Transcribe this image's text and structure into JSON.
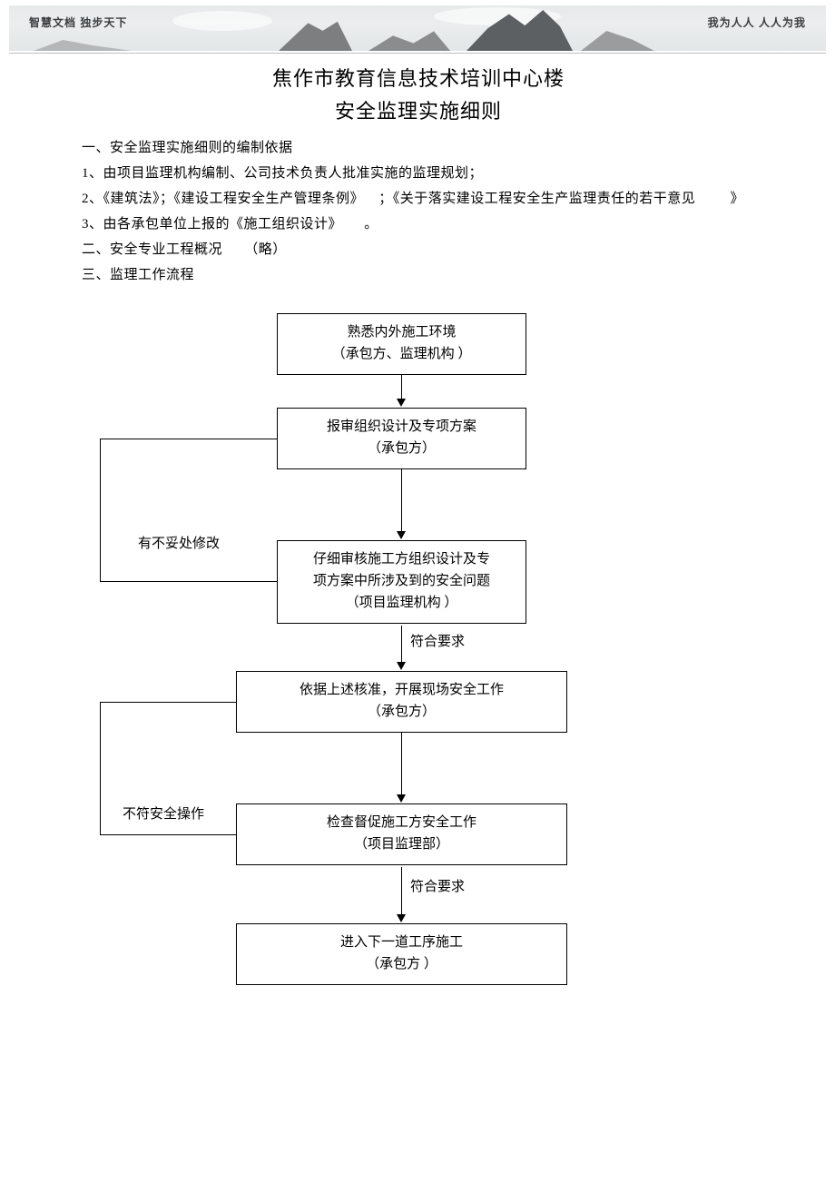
{
  "banner": {
    "left": "智慧文档  独步天下",
    "right": "我为人人  人人为我"
  },
  "title": "焦作市教育信息技术培训中心楼",
  "subtitle": "安全监理实施细则",
  "body": {
    "p1": "一、安全监理实施细则的编制依据",
    "p2": "1、由项目监理机构编制、公司技术负责人批准实施的监理规划；",
    "p3_a": "2、《建筑法》；《建设工程安全生产管理条例》",
    "p3_b": "；《关于落实建设工程安全生产监理责任的若干意见",
    "p3_c": "》",
    "p4_a": "3、由各承包单位上报的《施工组织设计》",
    "p4_b": "。",
    "p5_a": "二、安全专业工程概况",
    "p5_b": "（略）",
    "p6": "三、监理工作流程"
  },
  "flow": {
    "n1_l1": "熟悉内外施工环境",
    "n1_l2": "（承包方、监理机构   ）",
    "n2_l1": "报审组织设计及专项方案",
    "n2_l2": "（承包方）",
    "n3_l1": "仔细审核施工方组织设计及专",
    "n3_l2": "项方案中所涉及到的安全问题",
    "n3_l3": "（项目监理机构    ）",
    "n4_l1": "依据上述核准，开展现场安全工作",
    "n4_l2": "（承包方）",
    "n5_l1": "检查督促施工方安全工作",
    "n5_l2": "（项目监理部）",
    "n6_l1": "进入下一道工序施工",
    "n6_l2": "（承包方   ）",
    "e_ok1": "符合要求",
    "e_ok2": "符合要求",
    "e_back1": "有不妥处修改",
    "e_back2": "不符安全操作"
  }
}
